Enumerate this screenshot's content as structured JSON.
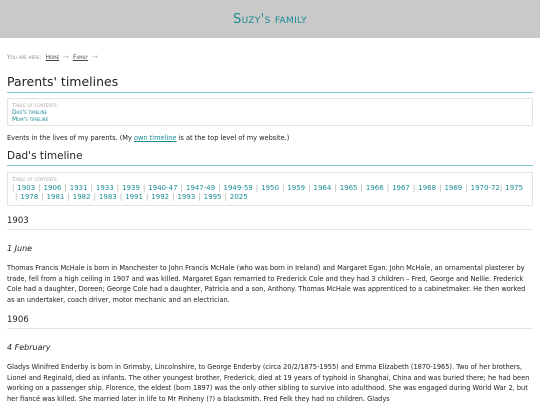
{
  "site": {
    "title": "Suzy's family"
  },
  "breadcrumb": {
    "prefix": "You are here:",
    "items": [
      "Home",
      "Family"
    ],
    "separator": "→"
  },
  "page": {
    "title": "Parents' timelines",
    "toc_label": "Table of contents:",
    "toc_items": [
      "Dad's timeline",
      "Mum's timeline"
    ],
    "intro_before": "Events in the lives of my parents. (My ",
    "intro_link": "own timeline",
    "intro_after": " is at the top level of my website.)"
  },
  "dad": {
    "heading": "Dad's timeline",
    "toc_label": "Table of contents:",
    "years": [
      "1903",
      "1906",
      "1931",
      "1933",
      "1939",
      "1940-47",
      "1947-49",
      "1949-59",
      "1950",
      "1959",
      "1964",
      "1965",
      "1966",
      "1967",
      "1968",
      "1969",
      "1970-72",
      "1975",
      "1978",
      "1981",
      "1982",
      "1983",
      "1991",
      "1992",
      "1993",
      "1995",
      "2025"
    ]
  },
  "entries": [
    {
      "year": "1903",
      "date": "1 June",
      "text": "Thomas Francis McHale is born in Manchester to John Francis McHale (who was born in Ireland) and Margaret Egan. John McHale, an ornamental plasterer by trade, fell from a high ceiling in 1907 and was killed. Margaret Egan remarried to Frederick Cole and they had 3 children – Fred, George and Nellie. Frederick Cole had a daughter, Doreen; George Cole had a daughter, Patricia and a son, Anthony. Thomas McHale was apprenticed to a cabinetmaker. He then worked as an undertaker, coach driver, motor mechanic and an electrician."
    },
    {
      "year": "1906",
      "date": "4 February",
      "text": "Gladys Winifred Enderby is born in Grimsby, Lincolnshire, to George Enderby (circa 20/2/1875-1955) and Emma Elizabeth (1870-1965). Two of her brothers, Lionel and Reginald, died as infants. The other youngest brother, Frederick, died at 19 years of typhoid in Shanghai, China and was buried there; he had been working on a passenger ship. Florence, the eldest (born 1897) was the only other sibling to survive into adulthood. She was engaged during World War 2, but her fiancé was killed. She married later in life to Mr Pinheny (?) a blacksmith. Fred Felk they had no children. Gladys"
    }
  ]
}
